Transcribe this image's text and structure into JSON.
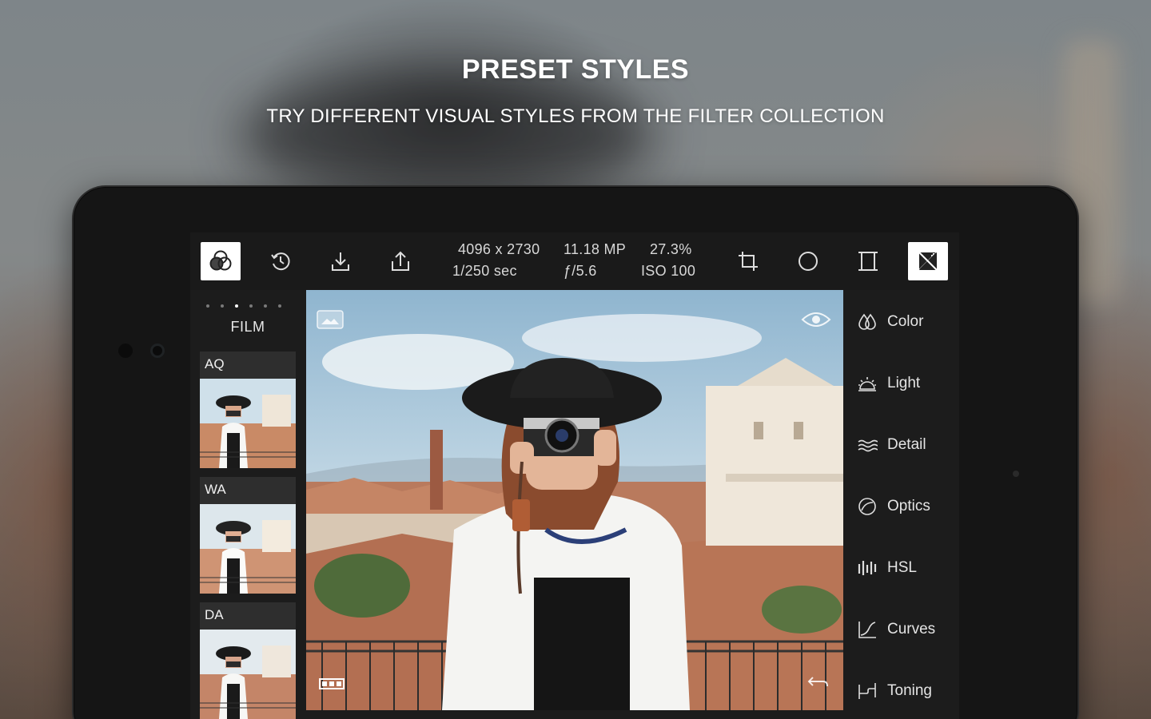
{
  "promo": {
    "headline": "PRESET STYLES",
    "subline": "TRY DIFFERENT VISUAL STYLES FROM THE FILTER COLLECTION"
  },
  "toolbar": {
    "left_icons": [
      "filters-icon",
      "history-icon",
      "download-icon",
      "share-icon"
    ],
    "right_icons": [
      "crop-icon",
      "vignette-icon",
      "frame-icon",
      "compare-icon"
    ],
    "active_left": "filters-icon",
    "active_right": "compare-icon"
  },
  "image_info": {
    "dimensions": "4096 x 2730",
    "megapixels": "11.18 MP",
    "zoom": "27.3%",
    "shutter": "1/250 sec",
    "aperture": "ƒ/5.6",
    "iso": "ISO 100"
  },
  "filters": {
    "page_dots": 6,
    "active_dot": 3,
    "category": "FILM",
    "items": [
      {
        "label": "AQ"
      },
      {
        "label": "WA"
      },
      {
        "label": "DA"
      }
    ]
  },
  "photo_overlay": {
    "top_left_icon": "image-icon",
    "top_right_icon": "eye-icon",
    "bottom_left_icon": "filmstrip-icon",
    "bottom_right_icon": "undo-icon"
  },
  "tools": [
    {
      "label": "Color",
      "icon": "color-drops-icon"
    },
    {
      "label": "Light",
      "icon": "light-sun-icon"
    },
    {
      "label": "Detail",
      "icon": "detail-waves-icon"
    },
    {
      "label": "Optics",
      "icon": "optics-lens-icon"
    },
    {
      "label": "HSL",
      "icon": "hsl-bars-icon"
    },
    {
      "label": "Curves",
      "icon": "curves-icon"
    },
    {
      "label": "Toning",
      "icon": "toning-icon"
    }
  ],
  "colors": {
    "panel_bg": "#1c1c1c",
    "active_button_bg": "#ffffff",
    "text": "#e4e4e4"
  }
}
